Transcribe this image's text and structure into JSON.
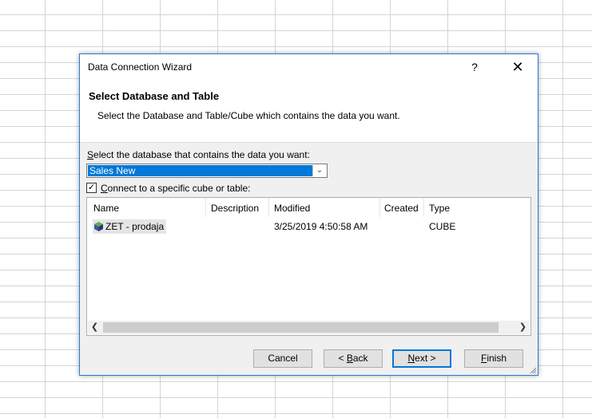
{
  "dialog": {
    "title": "Data Connection Wizard",
    "help_label": "?",
    "close_label": "✕",
    "header_title": "Select Database and Table",
    "header_subtitle": "Select the Database and Table/Cube which contains the data you want.",
    "db_label_key": "S",
    "db_label_rest": "elect the database that contains the data you want:",
    "database": {
      "selected": "Sales New"
    },
    "connect_checkbox": {
      "checked": true,
      "mnemonic": "C",
      "label_rest": "onnect to a specific cube or table:"
    },
    "table": {
      "columns": [
        "Name",
        "Description",
        "Modified",
        "Created",
        "Type"
      ],
      "rows": [
        {
          "name": "ZET - prodaja",
          "description": "",
          "modified": "3/25/2019 4:50:58 AM",
          "created": "",
          "type": "CUBE"
        }
      ]
    },
    "buttons": {
      "cancel": "Cancel",
      "back_prefix": "< ",
      "back_key": "B",
      "back_rest": "ack",
      "next_key": "N",
      "next_rest": "ext >",
      "finish_key": "F",
      "finish_rest": "inish"
    }
  }
}
